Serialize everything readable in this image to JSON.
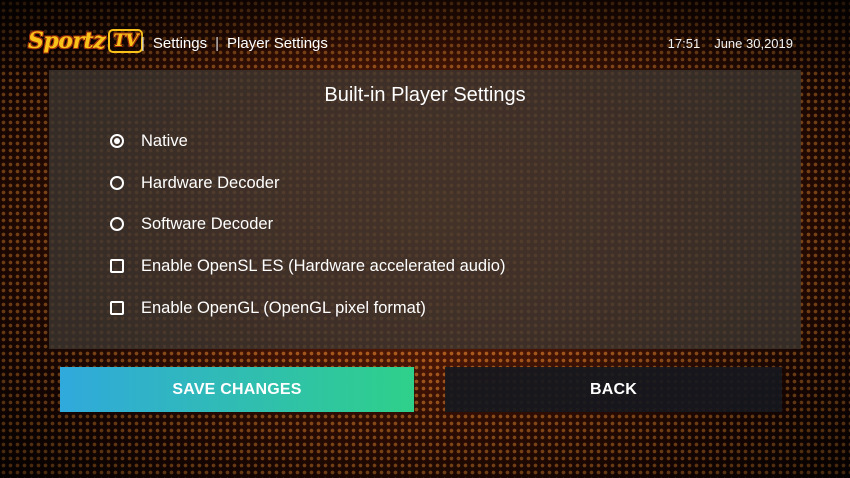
{
  "app": {
    "logo_text": "Sportz",
    "logo_tv": "TV"
  },
  "breadcrumb": {
    "items": [
      "Settings",
      "Player Settings"
    ],
    "separator": "|"
  },
  "status": {
    "time": "17:51",
    "date": "June 30,2019"
  },
  "panel": {
    "title": "Built-in Player Settings",
    "options": [
      {
        "label": "Native",
        "type": "radio",
        "checked": true
      },
      {
        "label": "Hardware Decoder",
        "type": "radio",
        "checked": false
      },
      {
        "label": "Software Decoder",
        "type": "radio",
        "checked": false
      },
      {
        "label": "Enable OpenSL ES (Hardware accelerated audio)",
        "type": "checkbox",
        "checked": false
      },
      {
        "label": "Enable OpenGL (OpenGL pixel format)",
        "type": "checkbox",
        "checked": false
      }
    ]
  },
  "buttons": {
    "save_label": "SAVE CHANGES",
    "back_label": "BACK"
  },
  "colors": {
    "save_gradient_start": "#30a9dc",
    "save_gradient_end": "#2fd08a",
    "logo": "#f9c31a"
  }
}
